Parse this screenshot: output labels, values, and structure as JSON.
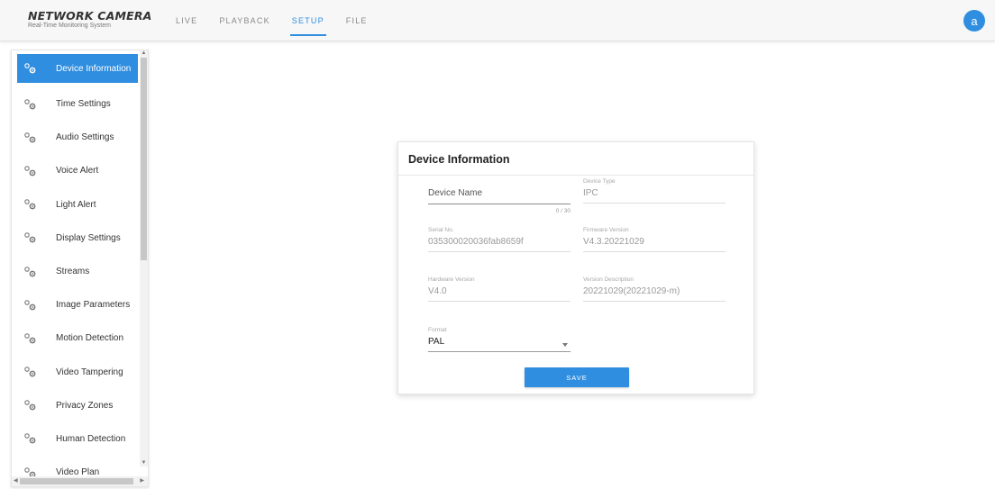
{
  "header": {
    "brand_title": "NETWORK CAMERA",
    "brand_subtitle": "Real-Time Monitoring System",
    "tabs": [
      {
        "label": "LIVE",
        "active": false
      },
      {
        "label": "PLAYBACK",
        "active": false
      },
      {
        "label": "SETUP",
        "active": true
      },
      {
        "label": "FILE",
        "active": false
      }
    ],
    "avatar_letter": "a"
  },
  "sidebar": {
    "items": [
      {
        "label": "Device Information",
        "icon": "gears-icon",
        "active": true
      },
      {
        "label": "Time Settings",
        "icon": "gears-icon",
        "active": false
      },
      {
        "label": "Audio Settings",
        "icon": "gears-icon",
        "active": false
      },
      {
        "label": "Voice Alert",
        "icon": "gears-icon",
        "active": false
      },
      {
        "label": "Light Alert",
        "icon": "gears-icon",
        "active": false
      },
      {
        "label": "Display Settings",
        "icon": "gears-icon",
        "active": false
      },
      {
        "label": "Streams",
        "icon": "gears-icon",
        "active": false
      },
      {
        "label": "Image Parameters",
        "icon": "gears-icon",
        "active": false
      },
      {
        "label": "Motion Detection",
        "icon": "gears-icon",
        "active": false
      },
      {
        "label": "Video Tampering",
        "icon": "gears-icon",
        "active": false
      },
      {
        "label": "Privacy Zones",
        "icon": "gears-icon",
        "active": false
      },
      {
        "label": "Human Detection",
        "icon": "gears-icon",
        "active": false
      },
      {
        "label": "Video Plan",
        "icon": "gears-icon",
        "active": false
      }
    ]
  },
  "panel": {
    "title": "Device Information",
    "device_name": {
      "placeholder": "Device Name",
      "value": "",
      "counter": "0 / 30"
    },
    "device_type": {
      "label": "Device Type",
      "value": "IPC"
    },
    "serial_no": {
      "label": "Serial No.",
      "value": "035300020036fab8659f"
    },
    "firmware_version": {
      "label": "Firmware Version",
      "value": "V4.3.20221029"
    },
    "hardware_version": {
      "label": "Hardware Version",
      "value": "V4.0"
    },
    "version_description": {
      "label": "Version Description",
      "value": "20221029(20221029-m)"
    },
    "format": {
      "label": "Format",
      "value": "PAL"
    },
    "save_label": "SAVE"
  },
  "colors": {
    "accent": "#2f8ee0",
    "header_bg": "#f7f7f7"
  }
}
